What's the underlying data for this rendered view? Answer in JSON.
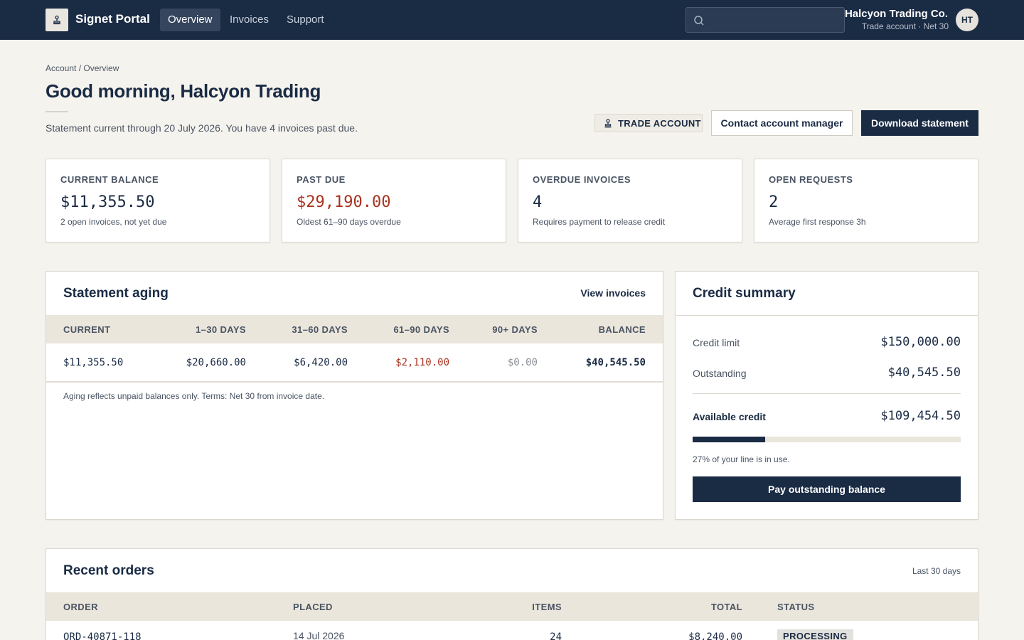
{
  "nav": {
    "brand": "Signet Portal",
    "tabs": [
      {
        "label": "Overview",
        "active": true
      },
      {
        "label": "Invoices",
        "active": false
      },
      {
        "label": "Support",
        "active": false
      }
    ],
    "search_value": "",
    "account_name": "Halcyon Trading Co.",
    "account_sub": "Trade account · Net 30",
    "avatar_initials": "HT"
  },
  "header": {
    "breadcrumb": "Account / Overview",
    "title": "Good morning, Halcyon Trading",
    "subtitle": "Statement current through 20 July 2026. You have 4 invoices past due.",
    "badge": "TRADE ACCOUNT",
    "contact_button": "Contact account manager",
    "download_button": "Download statement"
  },
  "stats": [
    {
      "label": "CURRENT BALANCE",
      "value": "$11,355.50",
      "note": "2 open invoices, not yet due"
    },
    {
      "label": "PAST DUE",
      "value": "$29,190.00",
      "note": "Oldest 61–90 days overdue"
    },
    {
      "label": "OVERDUE INVOICES",
      "value": "4",
      "note": "Requires payment to release credit"
    },
    {
      "label": "OPEN REQUESTS",
      "value": "2",
      "note": "Average first response 3h"
    }
  ],
  "aging": {
    "title": "Statement aging",
    "link": "View invoices",
    "headers": [
      "CURRENT",
      "1–30 DAYS",
      "31–60 DAYS",
      "61–90 DAYS",
      "90+ DAYS",
      "BALANCE"
    ],
    "values": [
      "$11,355.50",
      "$20,660.00",
      "$6,420.00",
      "$2,110.00",
      "$0.00",
      "$40,545.50"
    ],
    "note": "Aging reflects unpaid balances only. Terms: Net 30 from invoice date."
  },
  "credit": {
    "title": "Credit summary",
    "limit_label": "Credit limit",
    "limit_value": "$150,000.00",
    "outstanding_label": "Outstanding",
    "outstanding_value": "$40,545.50",
    "available_label": "Available credit",
    "available_value": "$109,454.50",
    "usage_fraction": 0.27,
    "note": "27% of your line is in use.",
    "pay_button": "Pay outstanding balance"
  },
  "orders": {
    "title": "Recent orders",
    "range": "Last 30 days",
    "headers": [
      "ORDER",
      "PLACED",
      "ITEMS",
      "TOTAL",
      "STATUS"
    ],
    "rows": [
      {
        "order": "ORD-40871-118",
        "placed": "14 Jul 2026",
        "items": "24",
        "total": "$8,240.00",
        "status": "PROCESSING"
      }
    ]
  },
  "colors": {
    "navy": "#1a2b44",
    "background": "#f5f3ee",
    "danger": "#a8321f",
    "table_header": "#ebe6dc"
  }
}
